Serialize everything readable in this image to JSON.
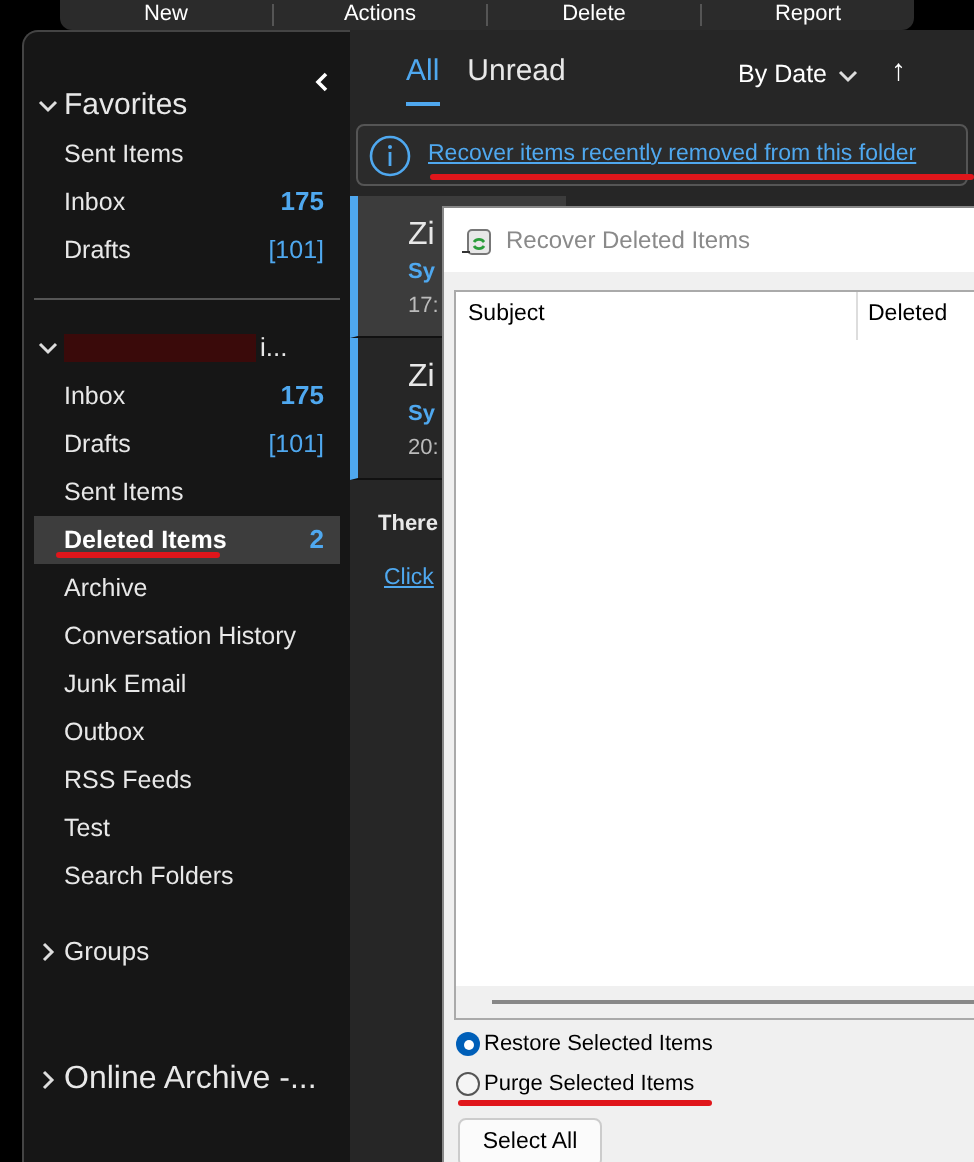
{
  "toolbar": [
    "New",
    "Actions",
    "Delete",
    "Report"
  ],
  "sidebar": {
    "sections": [
      {
        "title": "Favorites",
        "expanded": true,
        "items": [
          {
            "label": "Sent Items",
            "selected": false
          },
          {
            "label": "Inbox",
            "count": "175",
            "selected": false
          },
          {
            "label": "Drafts",
            "count": "[101]",
            "selected": false
          }
        ]
      },
      {
        "title": "i...",
        "expanded": true,
        "redacted": true,
        "items": [
          {
            "label": "Inbox",
            "count": "175",
            "selected": false
          },
          {
            "label": "Drafts",
            "count": "[101]",
            "selected": false
          },
          {
            "label": "Sent Items",
            "selected": false
          },
          {
            "label": "Deleted Items",
            "count": "2",
            "selected": true
          },
          {
            "label": "Archive",
            "selected": false
          },
          {
            "label": "Conversation History",
            "selected": false
          },
          {
            "label": "Junk Email",
            "selected": false
          },
          {
            "label": "Outbox",
            "selected": false
          },
          {
            "label": "RSS Feeds",
            "selected": false
          },
          {
            "label": "Test",
            "selected": false
          },
          {
            "label": "Search Folders",
            "selected": false
          }
        ]
      },
      {
        "title": "Groups",
        "expanded": false
      },
      {
        "title": "Online Archive -...",
        "expanded": false,
        "large": true
      }
    ]
  },
  "message_list": {
    "tabs": [
      {
        "label": "All",
        "selected": true
      },
      {
        "label": "Unread",
        "selected": false
      }
    ],
    "sort": "By Date",
    "sort_direction": "↑",
    "banner": "Recover items recently removed from this folder",
    "messages": [
      {
        "sender": "Zi",
        "subject": "Sy",
        "time": "17:",
        "selected": true
      },
      {
        "sender": "Zi",
        "subject": "Sy",
        "time": "20:",
        "selected": false
      }
    ],
    "footer_text": "There",
    "footer_link": "Click"
  },
  "dialog": {
    "title": "Recover Deleted Items",
    "columns": [
      "Subject",
      "Deleted"
    ],
    "options": [
      {
        "label": "Restore Selected Items",
        "selected": true
      },
      {
        "label": "Purge Selected Items",
        "selected": false
      }
    ],
    "buttons": [
      "Select All"
    ]
  }
}
